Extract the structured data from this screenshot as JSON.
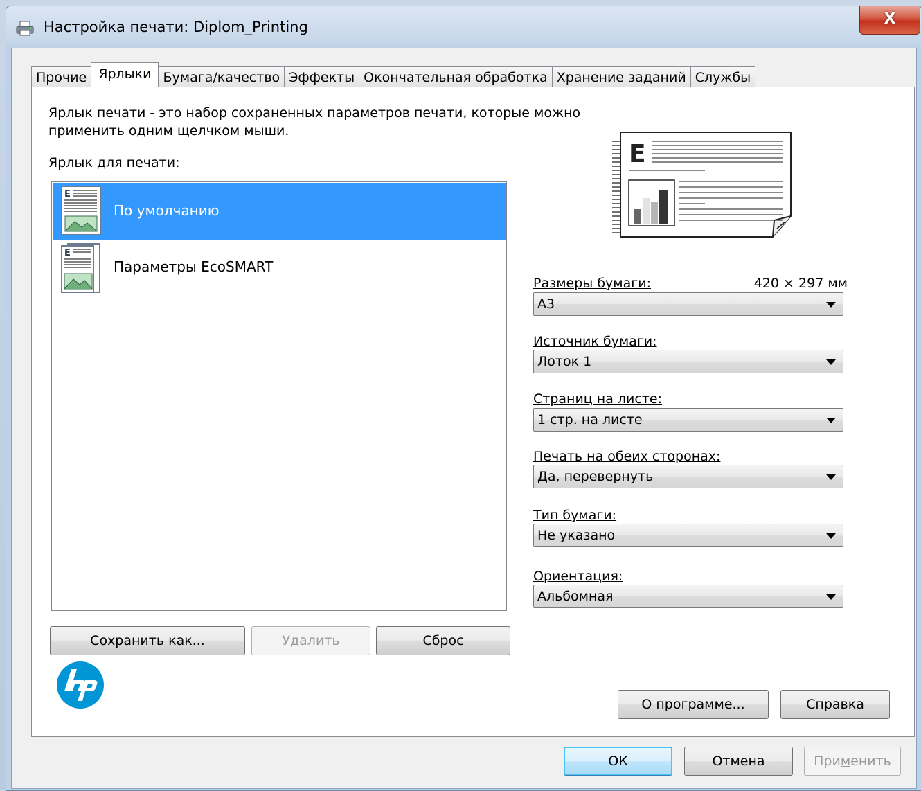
{
  "window": {
    "title": "Настройка печати: Diplom_Printing",
    "close_label": "X"
  },
  "tabs": [
    {
      "label": "Прочие"
    },
    {
      "label": "Ярлыки",
      "active": true
    },
    {
      "label": "Бумага/качество"
    },
    {
      "label": "Эффекты"
    },
    {
      "label": "Окончательная обработка"
    },
    {
      "label": "Хранение заданий"
    },
    {
      "label": "Службы"
    }
  ],
  "shortcuts": {
    "intro_line1": "Ярлык печати - это набор сохраненных параметров печати, которые можно",
    "intro_line2": "применить одним щелчком мыши.",
    "list_label": "Ярлык для печати:",
    "items": [
      {
        "label": "По умолчанию",
        "selected": true
      },
      {
        "label": "Параметры EcoSMART",
        "selected": false
      }
    ],
    "save_as_label": "Сохранить как...",
    "delete_label": "Удалить",
    "reset_label": "Сброс"
  },
  "settings": {
    "paper_size": {
      "label": "Размеры бумаги:",
      "dimensions": "420 × 297 мм",
      "value": "А3"
    },
    "paper_source": {
      "label": "Источник бумаги:",
      "value": "Лоток 1"
    },
    "pages_per_sheet": {
      "label": "Страниц на листе:",
      "value": "1 стр. на листе"
    },
    "duplex": {
      "label": "Печать на обеих сторонах:",
      "value": "Да, перевернуть"
    },
    "paper_type": {
      "label": "Тип бумаги:",
      "value": "Не указано"
    },
    "orientation": {
      "label": "Ориентация:",
      "value": "Альбомная"
    }
  },
  "panel_buttons": {
    "about_label": "О программе...",
    "help_label": "Справка"
  },
  "dialog_buttons": {
    "ok_label": "ОК",
    "cancel_label": "Отмена",
    "apply_prefix": "При",
    "apply_underlined": "м",
    "apply_suffix": "енить"
  },
  "colors": {
    "selection": "#3399ff",
    "hp_blue": "#0096d6",
    "close_red": "#c4321c"
  }
}
